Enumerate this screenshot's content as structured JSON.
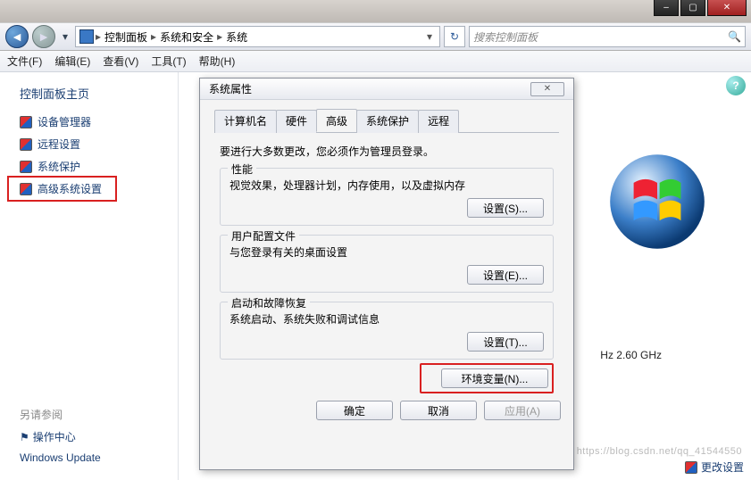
{
  "titlebar": {
    "min": "–",
    "max": "▢",
    "close": "✕"
  },
  "addr": {
    "bc1": "控制面板",
    "bc2": "系统和安全",
    "bc3": "系统",
    "search_placeholder": "搜索控制面板"
  },
  "menu": {
    "file": "文件(F)",
    "edit": "编辑(E)",
    "view": "查看(V)",
    "tools": "工具(T)",
    "help": "帮助(H)"
  },
  "sidebar": {
    "home": "控制面板主页",
    "items": [
      {
        "label": "设备管理器"
      },
      {
        "label": "远程设置"
      },
      {
        "label": "系统保护"
      },
      {
        "label": "高级系统设置"
      }
    ],
    "see_also": "另请参阅",
    "action_center": "操作中心",
    "win_update": "Windows Update"
  },
  "content": {
    "cpu_suffix": "Hz  2.60 GHz",
    "change_settings": "更改设置",
    "watermark": "https://blog.csdn.net/qq_41544550"
  },
  "dialog": {
    "title": "系统属性",
    "tabs": {
      "computer_name": "计算机名",
      "hardware": "硬件",
      "advanced": "高级",
      "protection": "系统保护",
      "remote": "远程"
    },
    "admin_note": "要进行大多数更改，您必须作为管理员登录。",
    "perf": {
      "legend": "性能",
      "desc": "视觉效果，处理器计划，内存使用，以及虚拟内存",
      "btn": "设置(S)..."
    },
    "profile": {
      "legend": "用户配置文件",
      "desc": "与您登录有关的桌面设置",
      "btn": "设置(E)..."
    },
    "startup": {
      "legend": "启动和故障恢复",
      "desc": "系统启动、系统失败和调试信息",
      "btn": "设置(T)..."
    },
    "env_btn": "环境变量(N)...",
    "ok": "确定",
    "cancel": "取消",
    "apply": "应用(A)"
  }
}
